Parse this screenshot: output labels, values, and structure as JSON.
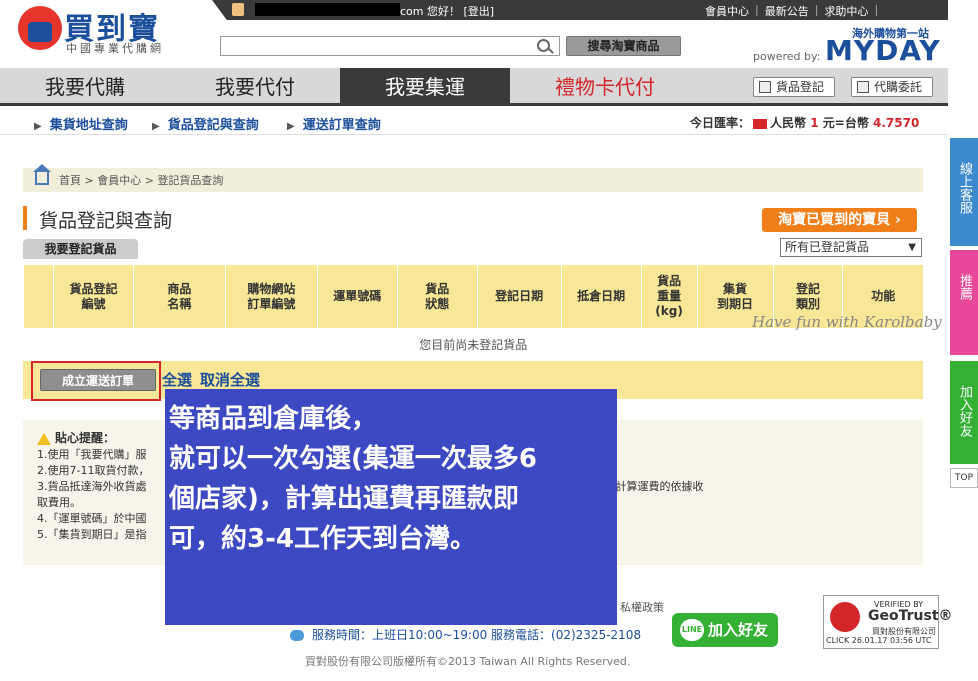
{
  "header": {
    "logo_text": "買到寶",
    "logo_sub": "中國專業代購網",
    "greeting": "com 您好！ [登出]",
    "top_links": [
      "會員中心",
      "最新公告",
      "求助中心"
    ],
    "search_placeholder": "",
    "search_button": "搜尋淘寶商品",
    "tagline": "海外購物第一站",
    "powered_by": "powered by:",
    "myday": "MYDAY"
  },
  "nav": {
    "tabs": [
      "我要代購",
      "我要代付",
      "我要集運",
      "禮物卡代付"
    ],
    "active": "我要集運",
    "buttons": [
      "貨品登記",
      "代購委託"
    ]
  },
  "subnav": {
    "items": [
      "集貨地址查詢",
      "貨品登記與查詢",
      "運送訂單查詢"
    ],
    "rate_label": "今日匯率：",
    "rate_currency": "人民幣",
    "rate_value": "1",
    "rate_mid": "元=台幣",
    "rate_twd": "4.7570"
  },
  "breadcrumb": "首頁 > 會員中心 > 登記貨品查詢",
  "page_title": "貨品登記與查詢",
  "taobao_button": "淘寶已買到的寶貝 ›",
  "register_button": "我要登記貨品",
  "filter_value": "所有已登記貨品",
  "table": {
    "headers": [
      "貨品登記\n編號",
      "商品\n名稱",
      "購物網站\n訂單編號",
      "運單號碼",
      "貨品\n狀態",
      "登記日期",
      "抵倉日期",
      "貨品\n重量\n(kg)",
      "集貨\n到期日",
      "登記\n類別",
      "功能"
    ],
    "empty_message": "您目前尚未登記貨品"
  },
  "actions": {
    "ship_button": "成立運送訂單",
    "select_all": "全選",
    "unselect_all": "取消全選"
  },
  "tips": {
    "title": "貼心提醒：",
    "lines": [
      "1.使用「我要代購」服",
      "2.使用7-11取貨付款，",
      "3.貨品抵達海外收貨處",
      "取費用。",
      "4.「運單號碼」於中國",
      "5.「集貨到期日」是指"
    ],
    "line3_tail": "，並於您成立運送訂單時，作為計算運費的依據收"
  },
  "overlay": {
    "lines": [
      "等商品到倉庫後，",
      "就可以一次勾選(集運一次最多6",
      "個店家)，計算出運費再匯款即",
      "可，約3-4工作天到台灣。"
    ]
  },
  "footer": {
    "policy": "私權政策",
    "service": "服務時間：上班日10:00~19:00 服務電話：(02)2325-2108",
    "line_button": "加入好友",
    "line_logo": "LINE",
    "copyright": "買對股份有限公司版權所有©2013 Taiwan All Rights Reserved."
  },
  "geotrust": {
    "verified": "VERIFIED BY",
    "brand": "GeoTrust®",
    "company": "買對股份有限公司",
    "click": "CLICK 26.01.17 03:56 UTC"
  },
  "watermark": "Have fun with Karolbaby",
  "side": {
    "chat": "線上客服",
    "recommend": "推薦",
    "line": "加入好友",
    "top": "TOP"
  },
  "colors": {
    "brand_blue": "#1b4e9b",
    "accent_orange": "#f07f1a",
    "table_yellow": "#f7e796",
    "overlay_blue": "#3d49c2",
    "line_green": "#34b135"
  }
}
